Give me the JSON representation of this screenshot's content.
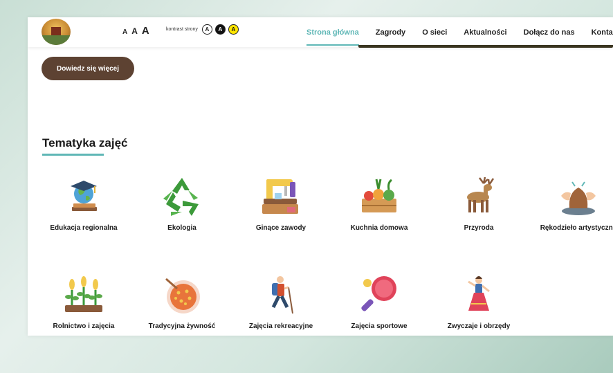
{
  "header": {
    "font_size_controls": [
      "A",
      "A",
      "A"
    ],
    "contrast_label": "kontrast strony",
    "contrast_options": [
      "A",
      "A",
      "A"
    ],
    "nav": [
      {
        "label": "Strona główna",
        "active": true
      },
      {
        "label": "Zagrody",
        "active": false
      },
      {
        "label": "O sieci",
        "active": false
      },
      {
        "label": "Aktualności",
        "active": false
      },
      {
        "label": "Dołącz do nas",
        "active": false
      },
      {
        "label": "Kontakt",
        "active": false
      }
    ]
  },
  "hero": {
    "cta_label": "Dowiedz się więcej"
  },
  "topics": {
    "title": "Tematyka zajęć",
    "items": [
      {
        "label": "Edukacja regionalna",
        "icon": "graduation-globe-icon"
      },
      {
        "label": "Ekologia",
        "icon": "recycle-icon"
      },
      {
        "label": "Ginące zawody",
        "icon": "sewing-machine-icon"
      },
      {
        "label": "Kuchnia domowa",
        "icon": "vegetable-crate-icon"
      },
      {
        "label": "Przyroda",
        "icon": "deer-icon"
      },
      {
        "label": "Rękodzieło artystyczne",
        "icon": "pottery-icon"
      },
      {
        "label": "Rolnictwo i zajęcia",
        "icon": "crops-icon"
      },
      {
        "label": "Tradycyjna żywność",
        "icon": "soup-bowl-icon"
      },
      {
        "label": "Zajęcia rekreacyjne",
        "icon": "hiker-icon"
      },
      {
        "label": "Zajęcia sportowe",
        "icon": "ping-pong-icon"
      },
      {
        "label": "Zwyczaje i obrzędy",
        "icon": "folk-dancer-icon"
      }
    ]
  },
  "colors": {
    "accent": "#5fb7b6",
    "button": "#5d4232",
    "nav_text": "#1f1f1f"
  }
}
